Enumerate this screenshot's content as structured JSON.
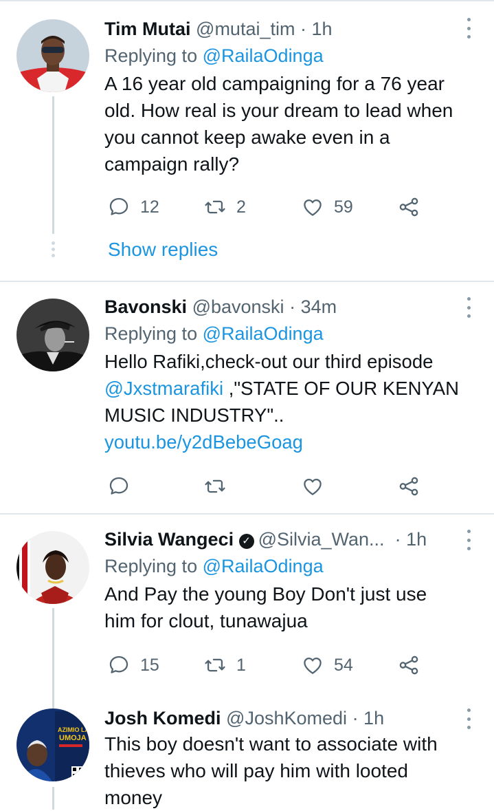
{
  "tweets": [
    {
      "display_name": "Tim Mutai",
      "handle": "@mutai_tim",
      "time": "· 1h",
      "replying_prefix": "Replying to",
      "replying_to": "@RailaOdinga",
      "text": "A 16 year old campaigning for a 76 year old. How real is your dream to lead when you cannot keep awake even in a campaign rally?",
      "replies": "12",
      "retweets": "2",
      "likes": "59",
      "show_replies": "Show replies"
    },
    {
      "display_name": "Bavonski",
      "handle": "@bavonski",
      "time": "· 34m",
      "replying_prefix": "Replying to",
      "replying_to": "@RailaOdinga",
      "text_part1": "Hello Rafiki,check-out our third episode",
      "mention": "@Jxstmarafiki",
      "text_part2": " ,\"STATE OF OUR KENYAN MUSIC INDUSTRY\"..",
      "link": "youtu.be/y2dBebeGoag"
    },
    {
      "display_name": "Silvia Wangeci",
      "handle": "@Silvia_Wan...",
      "time": "· 1h",
      "replying_prefix": "Replying to",
      "replying_to": "@RailaOdinga",
      "text": "And Pay the young Boy Don't just use him for clout, tunawajua",
      "replies": "15",
      "retweets": "1",
      "likes": "54"
    },
    {
      "display_name": "Josh Komedi",
      "handle": "@JoshKomedi",
      "time": "· 1h",
      "text": "This boy doesn't want to associate with thieves who will pay him with looted money",
      "avatar_text_line1": "AZIMIO LA",
      "avatar_text_line2": "UMOJA"
    }
  ],
  "icons": {
    "reply": "reply-icon",
    "retweet": "retweet-icon",
    "like": "heart-icon",
    "share": "share-icon",
    "menu": "more-vertical-icon",
    "verified": "verified-badge-icon"
  },
  "colors": {
    "link": "#1b95e0",
    "secondary_text": "#536471",
    "thread_line": "#cfd9de"
  }
}
